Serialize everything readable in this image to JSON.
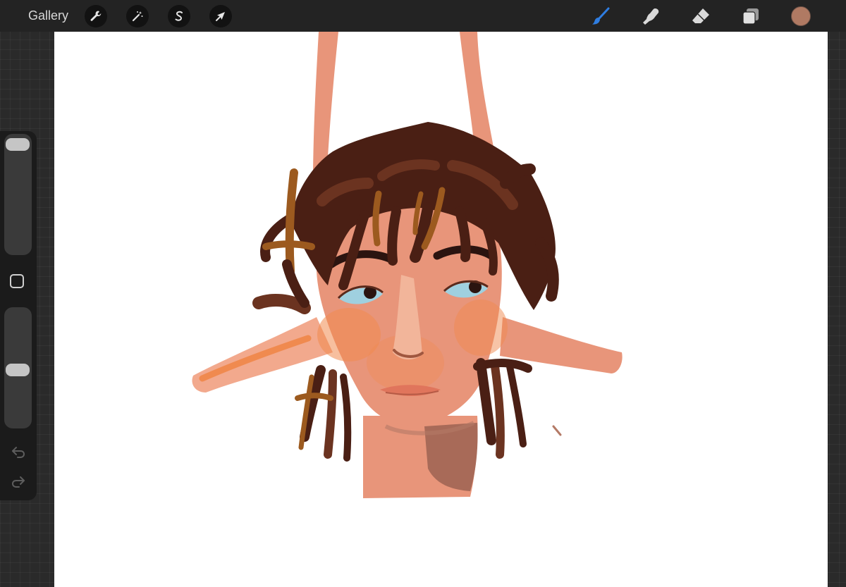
{
  "topbar": {
    "gallery_label": "Gallery",
    "left_tools": [
      {
        "name": "actions",
        "icon": "wrench-icon"
      },
      {
        "name": "adjustments",
        "icon": "magic-wand-icon"
      },
      {
        "name": "selection",
        "icon": "selection-s-icon"
      },
      {
        "name": "transform",
        "icon": "arrow-cursor-icon"
      }
    ],
    "right_tools": [
      {
        "name": "brush",
        "icon": "brush-icon",
        "active": true
      },
      {
        "name": "smudge",
        "icon": "smudge-finger-icon",
        "active": false
      },
      {
        "name": "eraser",
        "icon": "eraser-icon",
        "active": false
      },
      {
        "name": "layers",
        "icon": "layers-icon",
        "active": false
      }
    ],
    "current_color": "#b07a63",
    "active_tool_color": "#2f7de1"
  },
  "sidebar": {
    "brush_size": 0.0,
    "brush_opacity": 0.48,
    "modify_button": "square-icon",
    "undo": "undo-icon",
    "redo": "redo-icon"
  },
  "canvas": {
    "background": "#ffffff",
    "artwork": "painted-portrait",
    "palette": {
      "skin": "#e8957a",
      "skin_light": "#f2a98d",
      "hair_dark": "#4a1f14",
      "hair_mid": "#6b3320",
      "hair_highlight": "#9c5a1f",
      "blush": "#f08a4f",
      "eye_blue": "#9fd0df",
      "brow": "#2b1410"
    }
  }
}
